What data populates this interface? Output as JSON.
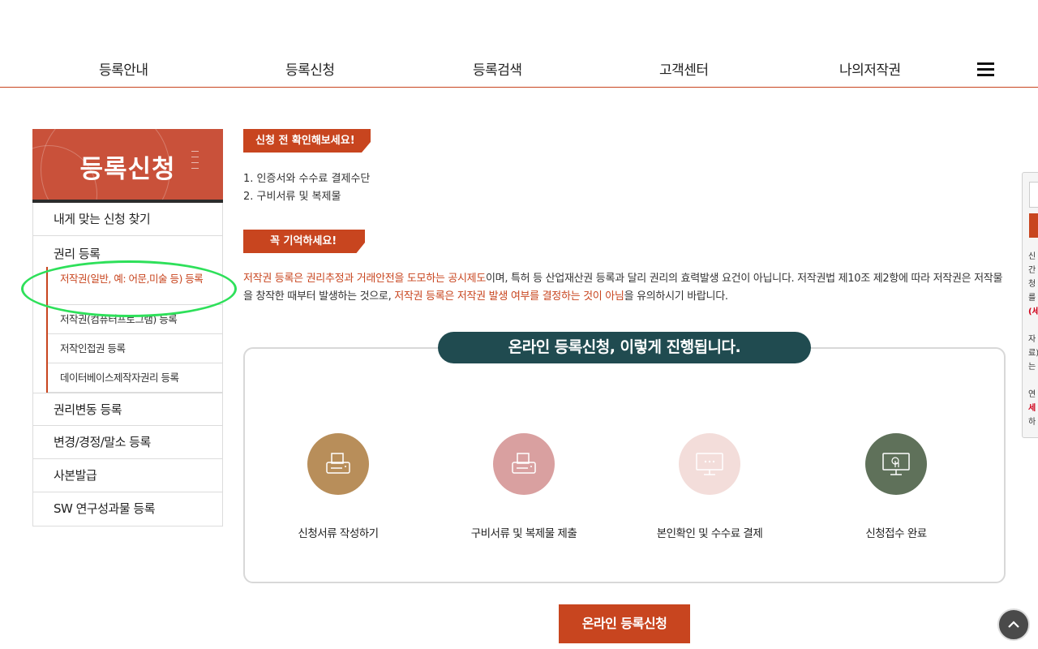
{
  "nav": {
    "items": [
      "등록안내",
      "등록신청",
      "등록검색",
      "고객센터",
      "나의저작권"
    ],
    "menu_icon": "hamburger-icon"
  },
  "sidebar": {
    "banner_title": "등록신청",
    "find": "내게 맞는 신청 찾기",
    "rights": "권리 등록",
    "sub": [
      "저작권(일반, 예: 어문,미술 등) 등록",
      "저작권(컴퓨터프로그램) 등록",
      "저작인접권 등록",
      "데이터베이스제작자권리 등록"
    ],
    "change": "권리변동 등록",
    "correction": "변경/경정/말소 등록",
    "copy": "사본발급",
    "sw": "SW 연구성과물 등록"
  },
  "main": {
    "tag1": "신청 전 확인해보세요!",
    "check1": "1. 인증서와 수수료 결제수단",
    "check2": "2. 구비서류 및 복제물",
    "tag2": "꼭 기억하세요!",
    "notice_hl1": "저작권 등록은 권리추정과 거래안전을 도모하는 공시제도",
    "notice_t1": "이며, 특허 등 산업재산권 등록과 달리 권리의 효력발생 요건이 아닙니다. 저작권법 제10조 제2항에 따라 저작권은 저작물을 창작한 때부터 발생하는 것으로, ",
    "notice_hl2": "저작권 등록은 저작권 발생 여부를 결정하는 것이 아님",
    "notice_t2": "을 유의하시기 바랍니다.",
    "process_title": "온라인 등록신청, 이렇게 진행됩니다.",
    "steps": [
      {
        "label": "신청서류 작성하기",
        "color": "#b88e5a",
        "icon": "printer-icon"
      },
      {
        "label": "구비서류 및 복제물 제출",
        "color": "#d9a0a0",
        "icon": "printer-icon"
      },
      {
        "label": "본인확인 및 수수료 결제",
        "color": "#f3ddda",
        "icon": "monitor-icon"
      },
      {
        "label": "신청접수 완료",
        "color": "#5f715a",
        "icon": "touch-screen-icon"
      }
    ],
    "apply_button": "온라인 등록신청"
  },
  "float_panel": {
    "lines": [
      "신",
      "간",
      "청",
      "를",
      "(세",
      "",
      "자",
      "료)",
      "는",
      "",
      "연",
      "세",
      "하"
    ]
  },
  "colors": {
    "accent": "#c8451f",
    "dark_teal": "#204b50",
    "highlight": "#2ee05a"
  }
}
